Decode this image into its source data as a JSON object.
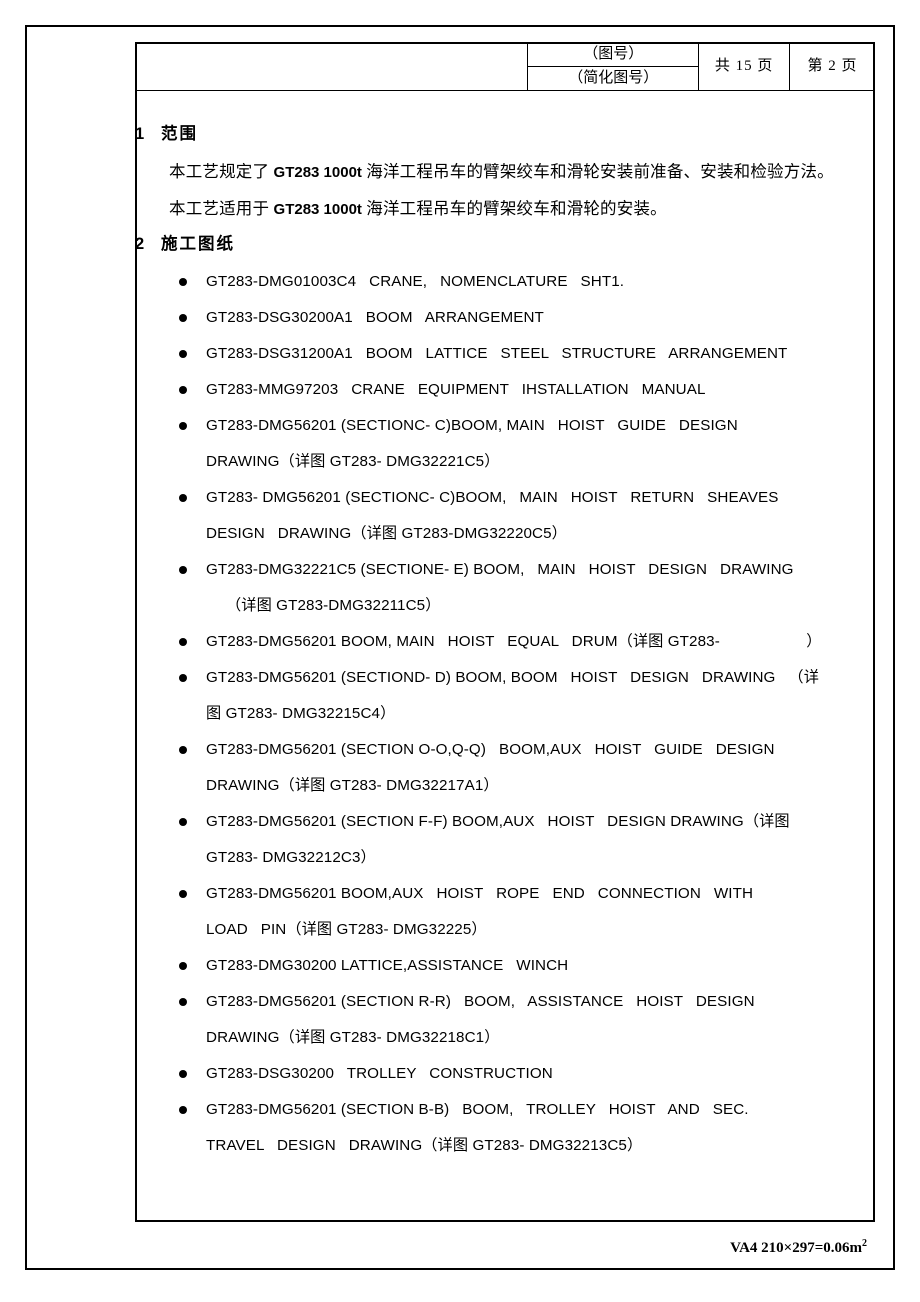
{
  "page": {
    "sheet_note": "VA4 210×297=0.06m",
    "sheet_note_sup": "2"
  },
  "header": {
    "blank_cell": "",
    "drawing_no_label": "（图号）",
    "simplified_drawing_no_label": "（简化图号）",
    "total_pages_prefix": "共",
    "total_pages_value": "15",
    "total_pages_suffix": "页",
    "current_page_prefix": "第",
    "current_page_value": "2",
    "current_page_suffix": "页"
  },
  "sections": [
    {
      "number": "1",
      "title": "范围",
      "paragraphs": [
        "本工艺规定了 GT283 1000t 海洋工程吊车的臂架绞车和滑轮安装前准备、安装和检验方法。",
        "本工艺适用于 GT283 1000t 海洋工程吊车的臂架绞车和滑轮的安装。"
      ]
    },
    {
      "number": "2",
      "title": "施工图纸"
    }
  ],
  "paragraph_parts": {
    "p1_a": "本工艺规定了 ",
    "p1_en": "GT283 1000t",
    "p1_b": " 海洋工程吊车的臂架绞车和滑轮安装前准备、安装和检验方法。",
    "p2_a": "本工艺适用于 ",
    "p2_en": "GT283 1000t",
    "p2_b": " 海洋工程吊车的臂架绞车和滑轮的安装。"
  },
  "drawing_list": [
    {
      "lines": [
        {
          "text": "GT283-DMG01003C4   CRANE,   NOMENCLATURE   SHT1."
        }
      ]
    },
    {
      "lines": [
        {
          "text": "GT283-DSG30200A1   BOOM   ARRANGEMENT"
        }
      ]
    },
    {
      "lines": [
        {
          "text": "GT283-DSG31200A1   BOOM   LATTICE   STEEL   STRUCTURE   ARRANGEMENT"
        }
      ]
    },
    {
      "lines": [
        {
          "text": "GT283-MMG97203   CRANE   EQUIPMENT   IHSTALLATION   MANUAL"
        }
      ]
    },
    {
      "lines": [
        {
          "text": "GT283-DMG56201 (SECTIONC- C)BOOM, MAIN   HOIST   GUIDE   DESIGN"
        },
        {
          "text": "DRAWING（详图 GT283- DMG32221C5）"
        }
      ]
    },
    {
      "lines": [
        {
          "text": "GT283- DMG56201 (SECTIONC- C)BOOM,   MAIN   HOIST   RETURN   SHEAVES"
        },
        {
          "text": "DESIGN   DRAWING（详图 GT283-DMG32220C5）"
        }
      ]
    },
    {
      "lines": [
        {
          "text": "GT283-DMG32221C5 (SECTIONE- E) BOOM,   MAIN   HOIST   DESIGN   DRAWING"
        },
        {
          "text": "（详图 GT283-DMG32211C5）",
          "indent": true
        }
      ]
    },
    {
      "lines": [
        {
          "text": "GT283-DMG56201 BOOM, MAIN   HOIST   EQUAL   DRUM（详图 GT283-                    ）"
        }
      ]
    },
    {
      "lines": [
        {
          "text": "GT283-DMG56201 (SECTIOND- D) BOOM, BOOM   HOIST   DESIGN   DRAWING   （详"
        },
        {
          "text": "图 GT283- DMG32215C4）"
        }
      ]
    },
    {
      "lines": [
        {
          "text": "GT283-DMG56201 (SECTION O-O,Q-Q)   BOOM,AUX   HOIST   GUIDE   DESIGN"
        },
        {
          "text": "DRAWING（详图 GT283- DMG32217A1）"
        }
      ]
    },
    {
      "lines": [
        {
          "text": "GT283-DMG56201 (SECTION F-F) BOOM,AUX   HOIST   DESIGN DRAWING（详图"
        },
        {
          "text": "GT283- DMG32212C3）"
        }
      ]
    },
    {
      "lines": [
        {
          "text": "GT283-DMG56201 BOOM,AUX   HOIST   ROPE   END   CONNECTION   WITH"
        },
        {
          "text": "LOAD   PIN（详图 GT283- DMG32225）"
        }
      ]
    },
    {
      "lines": [
        {
          "text": "GT283-DMG30200 LATTICE,ASSISTANCE   WINCH"
        }
      ]
    },
    {
      "lines": [
        {
          "text": "GT283-DMG56201 (SECTION R-R)   BOOM,   ASSISTANCE   HOIST   DESIGN"
        },
        {
          "text": "DRAWING（详图 GT283- DMG32218C1）"
        }
      ]
    },
    {
      "lines": [
        {
          "text": "GT283-DSG30200   TROLLEY   CONSTRUCTION"
        }
      ]
    },
    {
      "lines": [
        {
          "text": "GT283-DMG56201 (SECTION B-B)   BOOM,   TROLLEY   HOIST   AND   SEC."
        },
        {
          "text": "TRAVEL   DESIGN   DRAWING（详图 GT283- DMG32213C5）"
        }
      ]
    }
  ]
}
